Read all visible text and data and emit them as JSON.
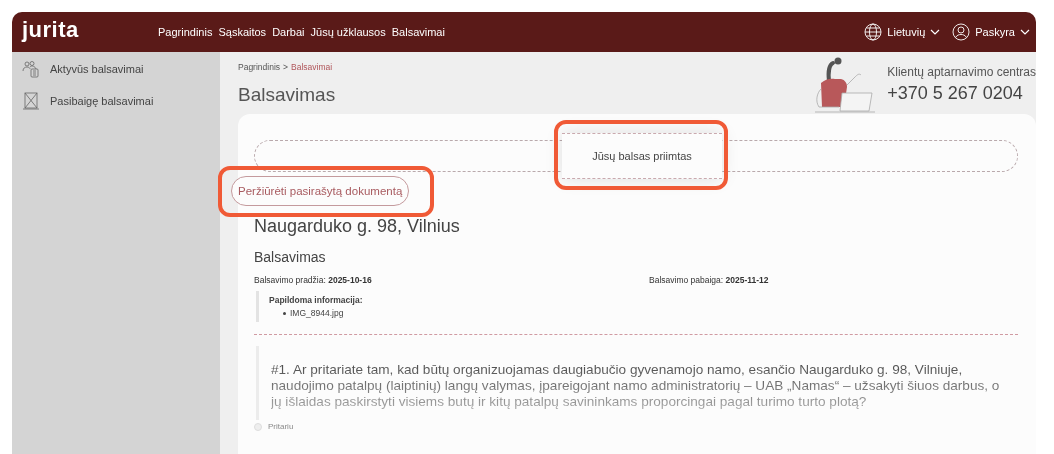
{
  "brand": {
    "logo": "jurita"
  },
  "nav": [
    "Pagrindinis",
    "Sąskaitos",
    "Darbai",
    "Jūsų užklausos",
    "Balsavimai"
  ],
  "header_right": {
    "language": "Lietuvių",
    "account": "Paskyra"
  },
  "sidebar": {
    "items": [
      {
        "label": "Aktyvūs balsavimai",
        "kind": "active"
      },
      {
        "label": "Pasibaigę balsavimai",
        "kind": "finished"
      }
    ]
  },
  "breadcrumb": {
    "items": [
      {
        "label": "Pagrindinis",
        "selected": false
      },
      {
        "label": "Balsavimai",
        "selected": true
      }
    ],
    "separator": ">"
  },
  "page_title": "Balsavimas",
  "support": {
    "title": "Klientų aptarnavimo centras",
    "phone": "+370 5 267 0204"
  },
  "toast": {
    "message": "Jūsų balsas priimtas",
    "highlighted": true
  },
  "document_button": {
    "label": "Peržiūrėti pasirašytą dokumentą",
    "highlighted": true
  },
  "address": "Naugarduko g. 98, Vilnius",
  "section_title": "Balsavimas",
  "dates": [
    {
      "label": "Balsavimo pradžia:",
      "value": "2025-10-16"
    },
    {
      "label": "Balsavimo pabaiga:",
      "value": "2025-11-12"
    }
  ],
  "additional_info": {
    "title": "Papildoma informacija:",
    "files": [
      "IMG_8944.jpg"
    ]
  },
  "question": {
    "text": "#1. Ar pritariate tam, kad būtų organizuojamas daugiabučio gyvenamojo namo, esančio Naugarduko g. 98, Vilniuje, naudojimo patalpų (laiptinių) langų valymas, įpareigojant namo administratorių – UAB „Namas“ – užsakyti šiuos darbus, o jų išlaidas paskirstyti visiems butų ir kitų patalpų savininkams proporcingai pagal turimo turto plotą?"
  },
  "options": [
    {
      "label": "Pritariu",
      "selected": false
    }
  ]
}
